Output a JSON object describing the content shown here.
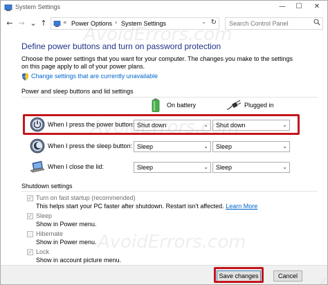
{
  "window": {
    "title": "System Settings",
    "minimize_glyph": "—",
    "maximize_glyph": "☐",
    "close_glyph": "✕"
  },
  "nav": {
    "back_glyph": "←",
    "forward_glyph": "→",
    "recent_glyph": "⌄",
    "up_glyph": "↑",
    "breadcrumb_chevron": "«",
    "breadcrumb_sep": "›",
    "breadcrumbs": [
      "Power Options",
      "System Settings"
    ],
    "refresh_glyph": "↻",
    "dropdown_glyph": "⌄",
    "search_placeholder": "Search Control Panel"
  },
  "content": {
    "heading": "Define power buttons and turn on password protection",
    "description": "Choose the power settings that you want for your computer. The changes you make to the settings on this page apply to all of your power plans.",
    "unavailable_link": "Change settings that are currently unavailable",
    "power_section": {
      "label": "Power and sleep buttons and lid settings",
      "col_battery": "On battery",
      "col_plugged": "Plugged in",
      "rows": [
        {
          "label": "When I press the power button:",
          "battery": "Shut down",
          "plugged": "Shut down",
          "icon": "power-icon"
        },
        {
          "label": "When I press the sleep button:",
          "battery": "Sleep",
          "plugged": "Sleep",
          "icon": "sleep-icon"
        },
        {
          "label": "When I close the lid:",
          "battery": "Sleep",
          "plugged": "Sleep",
          "icon": "laptop-lid-icon"
        }
      ],
      "dropdown_arrow": "⌄"
    },
    "shutdown_section": {
      "label": "Shutdown settings",
      "check_glyph": "✓",
      "items": [
        {
          "label": "Turn on fast startup (recommended)",
          "checked": true,
          "desc": "This helps start your PC faster after shutdown. Restart isn't affected.",
          "link": "Learn More"
        },
        {
          "label": "Sleep",
          "checked": true,
          "desc": "Show in Power menu."
        },
        {
          "label": "Hibernate",
          "checked": false,
          "desc": "Show in Power menu."
        },
        {
          "label": "Lock",
          "checked": true,
          "desc": "Show in account picture menu."
        }
      ]
    }
  },
  "footer": {
    "save_label": "Save changes",
    "cancel_label": "Cancel",
    "grip_glyph": "⋰"
  },
  "watermark": "AvoidErrors.com",
  "colors": {
    "heading": "#1e3287",
    "link": "#0066cc",
    "highlight": "#c3161c"
  }
}
